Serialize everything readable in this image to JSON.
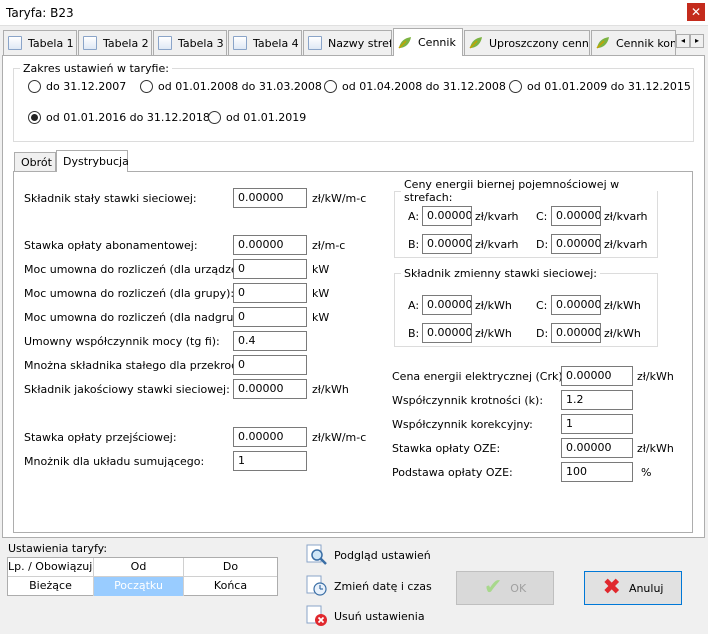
{
  "window": {
    "title": "Taryfa: B23",
    "close_glyph": "✕"
  },
  "tabs": [
    {
      "label": "Tabela 1",
      "icon": "document-icon"
    },
    {
      "label": "Tabela 2",
      "icon": "document-icon"
    },
    {
      "label": "Tabela 3",
      "icon": "document-icon"
    },
    {
      "label": "Tabela 4",
      "icon": "document-icon"
    },
    {
      "label": "Nazwy stref",
      "icon": "document-icon"
    },
    {
      "label": "Cennik",
      "icon": "leaf-icon",
      "active": true
    },
    {
      "label": "Uproszczony cennik",
      "icon": "leaf-icon"
    },
    {
      "label": "Cennik komu",
      "icon": "leaf-icon"
    }
  ],
  "tab_scroll": {
    "left": "◂",
    "right": "▸"
  },
  "range": {
    "legend": "Zakres ustawień w taryfie:",
    "options": [
      {
        "label": "do 31.12.2007",
        "selected": false
      },
      {
        "label": "od 01.01.2008 do 31.03.2008",
        "selected": false
      },
      {
        "label": "od 01.04.2008 do 31.12.2008",
        "selected": false
      },
      {
        "label": "od 01.01.2009 do 31.12.2015",
        "selected": false
      },
      {
        "label": "od 01.01.2016 do 31.12.2018",
        "selected": true
      },
      {
        "label": "od 01.01.2019",
        "selected": false
      }
    ]
  },
  "subtabs": [
    {
      "label": "Obrót"
    },
    {
      "label": "Dystrybucja",
      "active": true
    }
  ],
  "left_fields": [
    {
      "label": "Składnik stały stawki sieciowej:",
      "value": "0.00000",
      "unit": "zł/kW/m-c"
    },
    {
      "label": "Stawka opłaty abonamentowej:",
      "value": "0.00000",
      "unit": "zł/m-c"
    },
    {
      "label": "Moc umowna do rozliczeń (dla urządzenia):",
      "value": "0",
      "unit": "kW"
    },
    {
      "label": "Moc umowna do rozliczeń (dla grupy):",
      "value": "0",
      "unit": "kW"
    },
    {
      "label": "Moc umowna do rozliczeń (dla nadgrupy):",
      "value": "0",
      "unit": "kW"
    },
    {
      "label": "Umowny współczynnik mocy (tg fi):",
      "value": "0.4",
      "unit": ""
    },
    {
      "label": "Mnożna składnika stałego dla przekroczeń:",
      "value": "0",
      "unit": ""
    },
    {
      "label": "Składnik jakościowy stawki sieciowej:",
      "value": "0.00000",
      "unit": "zł/kWh"
    },
    {
      "label": "Stawka opłaty przejściowej:",
      "value": "0.00000",
      "unit": "zł/kW/m-c"
    },
    {
      "label": "Mnożnik dla układu sumującego:",
      "value": "1",
      "unit": ""
    }
  ],
  "reactive_group": {
    "legend": "Ceny energii biernej pojemnościowej w strefach:",
    "fields": [
      {
        "label": "A:",
        "value": "0.00000",
        "unit": "zł/kvarh"
      },
      {
        "label": "C:",
        "value": "0.00000",
        "unit": "zł/kvarh"
      },
      {
        "label": "B:",
        "value": "0.00000",
        "unit": "zł/kvarh"
      },
      {
        "label": "D:",
        "value": "0.00000",
        "unit": "zł/kvarh"
      }
    ]
  },
  "variable_group": {
    "legend": "Składnik zmienny stawki sieciowej:",
    "fields": [
      {
        "label": "A:",
        "value": "0.00000",
        "unit": "zł/kWh"
      },
      {
        "label": "C:",
        "value": "0.00000",
        "unit": "zł/kWh"
      },
      {
        "label": "B:",
        "value": "0.00000",
        "unit": "zł/kWh"
      },
      {
        "label": "D:",
        "value": "0.00000",
        "unit": "zł/kWh"
      }
    ]
  },
  "right_fields": [
    {
      "label": "Cena energii elektrycznej (Crk):",
      "value": "0.00000",
      "unit": "zł/kWh"
    },
    {
      "label": "Współczynnik krotności (k):",
      "value": "1.2",
      "unit": ""
    },
    {
      "label": "Współczynnik korekcyjny:",
      "value": "1",
      "unit": ""
    },
    {
      "label": "Stawka opłaty OZE:",
      "value": "0.00000",
      "unit": "zł/kWh"
    },
    {
      "label": "Podstawa opłaty OZE:",
      "value": "100",
      "unit": "%"
    }
  ],
  "settings": {
    "label": "Ustawienia taryfy:",
    "headers": [
      "Lp. / Obowiązują",
      "Od",
      "Do"
    ],
    "row": [
      "Bieżące",
      "Początku",
      "Końca"
    ]
  },
  "actions": [
    {
      "label": "Podgląd ustawień",
      "icon": "magnifier-icon"
    },
    {
      "label": "Zmień datę i czas",
      "icon": "clock-icon"
    },
    {
      "label": "Usuń ustawienia",
      "icon": "delete-icon"
    }
  ],
  "buttons": {
    "ok": {
      "label": "OK",
      "icon": "✔"
    },
    "cancel": {
      "label": "Anuluj",
      "icon": "✖"
    }
  },
  "colors": {
    "accent": "#0078d7",
    "selection": "#99ccff",
    "ok_check": "#7cc45a",
    "cancel_x": "#e0282e"
  }
}
